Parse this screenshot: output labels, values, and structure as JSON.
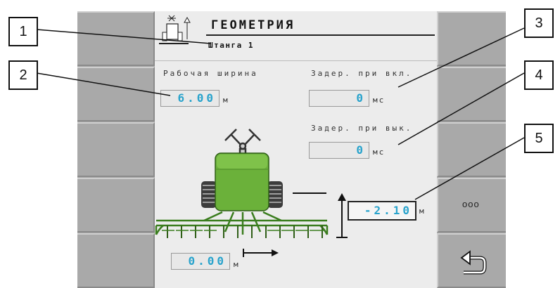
{
  "header": {
    "title": "ГЕОМЕТРИЯ",
    "subtitle": "Штанга 1"
  },
  "fields": {
    "working_width": {
      "label": "Рабочая ширина",
      "value": "6.00",
      "unit": "м"
    },
    "delay_on": {
      "label": "Задер. при вкл.",
      "value": "0",
      "unit": "мс"
    },
    "delay_off": {
      "label": "Задер. при вык.",
      "value": "0",
      "unit": "мс"
    },
    "vertical_offset": {
      "value": "-2.10",
      "unit": "м"
    },
    "horizontal_offset": {
      "value": "0.00",
      "unit": "м"
    }
  },
  "callouts": [
    "1",
    "2",
    "3",
    "4",
    "5"
  ],
  "softkeys": {
    "more_label": "ooo",
    "back_icon": "return-arrow-icon"
  },
  "colors": {
    "value_text": "#29a3cc",
    "tank_green": "#6bb13a"
  }
}
